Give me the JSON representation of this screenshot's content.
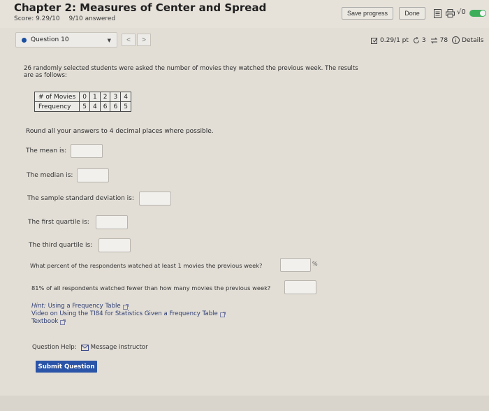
{
  "header": {
    "title": "Chapter 2: Measures of Center and Spread",
    "score": "Score: 9.29/10",
    "answered": "9/10 answered",
    "save_label": "Save progress",
    "done_label": "Done",
    "math_label": "√0"
  },
  "question_bar": {
    "selected": "Question 10",
    "prev": "<",
    "next": ">",
    "points": "0.29/1 pt",
    "retries": "3",
    "attempts": "78",
    "details": "Details"
  },
  "problem": {
    "text": "26 randomly selected students were asked the number of movies they watched the previous week. The results are as follows:",
    "table": {
      "row1_header": "# of Movies",
      "row2_header": "Frequency",
      "movies": [
        "0",
        "1",
        "2",
        "3",
        "4"
      ],
      "frequency": [
        "5",
        "4",
        "6",
        "6",
        "5"
      ]
    },
    "round_note": "Round all your answers to 4 decimal places where possible."
  },
  "questions": [
    {
      "label": "The mean is:",
      "value": ""
    },
    {
      "label": "The median is:",
      "value": ""
    },
    {
      "label": "The sample standard deviation is:",
      "value": ""
    },
    {
      "label": "The first quartile is:",
      "value": ""
    },
    {
      "label": "The third quartile is:",
      "value": ""
    },
    {
      "label": "What percent of the respondents watched at least 1 movies the previous week?",
      "value": ""
    },
    {
      "label": "81% of all respondents watched fewer than how many movies the previous week?",
      "value": ""
    }
  ],
  "percent_sign": "%",
  "hints": {
    "hint_label": "Hint:",
    "hint_link": "Using a Frequency Table",
    "video_link": "Video on Using the TI84 for Statistics Given a Frequency Table",
    "textbook_link": "Textbook"
  },
  "help": {
    "label": "Question Help:",
    "message": "Message instructor"
  },
  "submit_label": "Submit Question",
  "colors": {
    "accent": "#2a54a8",
    "toggle": "#3fae5a",
    "question_dot": "#1b4fa0",
    "link": "#2f3d73"
  }
}
